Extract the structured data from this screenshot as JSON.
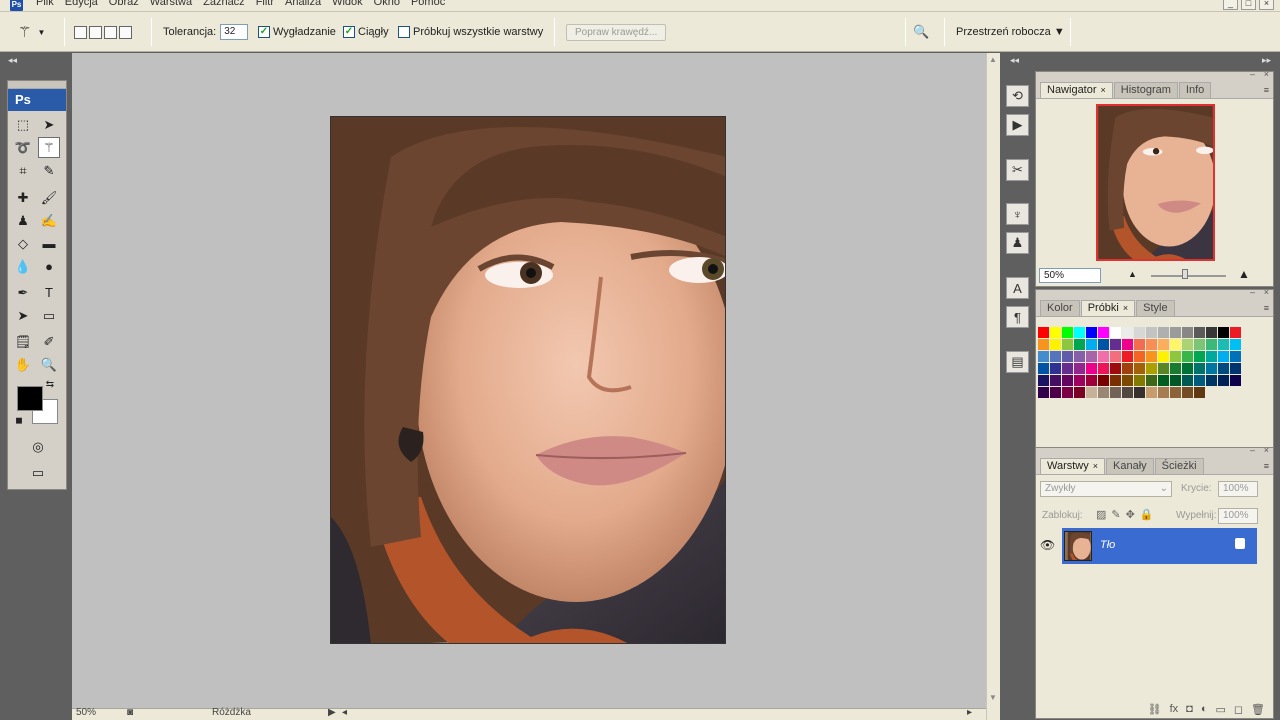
{
  "app": {
    "logo_label": "Ps"
  },
  "menu": [
    "Plik",
    "Edycja",
    "Obraz",
    "Warstwa",
    "Zaznacz",
    "Filtr",
    "Analiza",
    "Widok",
    "Okno",
    "Pomoc"
  ],
  "window_controls": [
    "_",
    "□",
    "×"
  ],
  "options": {
    "tolerance_label": "Tolerancja:",
    "tolerance_value": "32",
    "antialias_label": "Wygładzanie",
    "antialias_checked": "✓",
    "contiguous_label": "Ciągły",
    "contiguous_checked": "✓",
    "sample_all_label": "Próbkuj wszystkie warstwy",
    "refine_edge_label": "Popraw krawędź...",
    "workspace_label": "Przestrzeń robocza ▼"
  },
  "status": {
    "zoom": "50%",
    "tool_name": "Różdżka"
  },
  "navigator": {
    "tabs": [
      "Nawigator",
      "Histogram",
      "Info"
    ],
    "zoom": "50%"
  },
  "swatches_panel": {
    "tabs": [
      "Kolor",
      "Próbki",
      "Style"
    ]
  },
  "layers": {
    "tabs": [
      "Warstwy",
      "Kanały",
      "Ścieżki"
    ],
    "blend_mode": "Zwykły",
    "opacity_label": "Krycie:",
    "opacity_value": "100%",
    "lock_label": "Zablokuj:",
    "fill_label": "Wypełnij:",
    "fill_value": "100%",
    "layer_name": "Tło"
  },
  "colors": {
    "accent_blue": "#3a6bd0",
    "toolbox_header": "#2a5ba8",
    "canvas_bg": "#c0c0c0",
    "dock_bg": "#5f5f5f"
  },
  "swatch_colors": [
    "#ff0000",
    "#ffff00",
    "#00ff00",
    "#00ffff",
    "#0000ff",
    "#ff00ff",
    "#ffffff",
    "#ebebeb",
    "#d7d7d7",
    "#c3c3c3",
    "#afafaf",
    "#9b9b9b",
    "#878787",
    "#5a5a5a",
    "#373737",
    "#000000",
    "#ed1c24",
    "#f7941d",
    "#fff200",
    "#8dc63f",
    "#00a651",
    "#00aeef",
    "#0054a6",
    "#662d91",
    "#ec008c",
    "#f26c4f",
    "#f68e56",
    "#fbaf5d",
    "#fff568",
    "#acd373",
    "#7cc576",
    "#3cb878",
    "#1cbbb4",
    "#00bff3",
    "#448ccb",
    "#5674b9",
    "#605ca8",
    "#855fa8",
    "#a864a8",
    "#f06eaa",
    "#f26d7d",
    "#ed1c24",
    "#f26522",
    "#f7941d",
    "#fff200",
    "#8dc63f",
    "#39b54a",
    "#00a651",
    "#00a99d",
    "#00aeef",
    "#0072bc",
    "#0054a6",
    "#2e3192",
    "#662d91",
    "#92278f",
    "#ec008c",
    "#ed145b",
    "#9e0b0f",
    "#a0410d",
    "#a36209",
    "#aba000",
    "#598527",
    "#197b30",
    "#007236",
    "#00746b",
    "#0076a3",
    "#004a80",
    "#003471",
    "#1b1464",
    "#440e62",
    "#630460",
    "#9e005d",
    "#9e0039",
    "#790000",
    "#7b2e00",
    "#7d4900",
    "#827b00",
    "#406618",
    "#005e20",
    "#005826",
    "#005952",
    "#005b7f",
    "#003663",
    "#002157",
    "#0d004c",
    "#32004b",
    "#4b0049",
    "#7b0046",
    "#7a0026",
    "#c7b299",
    "#998675",
    "#736357",
    "#534741",
    "#37302d",
    "#c69c6d",
    "#a67c52",
    "#8c6239",
    "#754c24",
    "#603913"
  ]
}
